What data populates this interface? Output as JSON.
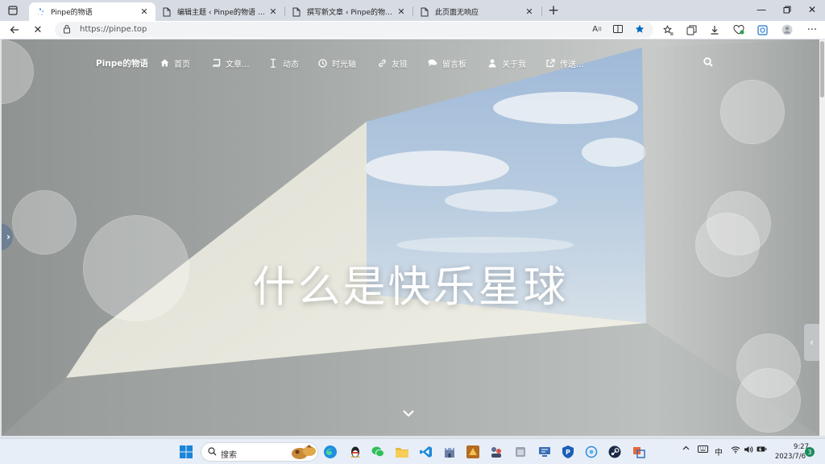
{
  "browser": {
    "tabs": [
      {
        "title": "Pinpe的物语",
        "active": true
      },
      {
        "title": "编辑主题 ‹ Pinpe的物语 — WordPress",
        "active": false
      },
      {
        "title": "撰写新文章 ‹ Pinpe的物语 — WordPress",
        "active": false
      },
      {
        "title": "此页面无响应",
        "active": false
      }
    ],
    "url": "https://pinpe.top"
  },
  "site": {
    "brand": "Pinpe的物语",
    "nav": [
      {
        "label": "首页",
        "icon": "home-icon"
      },
      {
        "label": "文章...",
        "icon": "book-icon"
      },
      {
        "label": "动态",
        "icon": "text-cursor-icon"
      },
      {
        "label": "时光轴",
        "icon": "clock-icon"
      },
      {
        "label": "友链",
        "icon": "link-icon"
      },
      {
        "label": "留言板",
        "icon": "comments-icon"
      },
      {
        "label": "关于我",
        "icon": "user-icon"
      },
      {
        "label": "传送...",
        "icon": "external-link-icon"
      }
    ],
    "hero_title": "什么是快乐星球"
  },
  "taskbar": {
    "search_placeholder": "搜索",
    "ime": "中",
    "time": "9:27",
    "date": "2023/7/6",
    "notification_count": "3"
  },
  "colors": {
    "accent": "#0067c0",
    "notif": "#1a8a5a",
    "handle": "#6c7f93"
  }
}
